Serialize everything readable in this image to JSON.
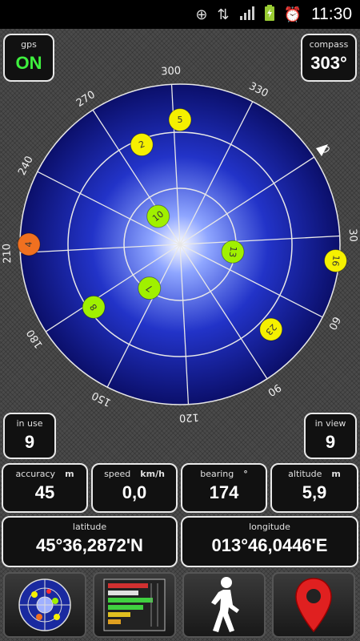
{
  "statusbar": {
    "time": "11:30",
    "icons": [
      "gps-icon",
      "data-transfer-icon",
      "signal-icon",
      "battery-icon",
      "alarm-icon"
    ]
  },
  "gps": {
    "label": "gps",
    "value": "ON"
  },
  "compass": {
    "label": "compass",
    "value": "303°"
  },
  "in_use": {
    "label": "in use",
    "value": "9"
  },
  "in_view": {
    "label": "in view",
    "value": "9"
  },
  "accuracy": {
    "label": "accuracy",
    "unit": "m",
    "value": "45"
  },
  "speed": {
    "label": "speed",
    "unit": "km/h",
    "value": "0,0"
  },
  "bearing": {
    "label": "bearing",
    "unit": "°",
    "value": "174"
  },
  "altitude": {
    "label": "altitude",
    "unit": "m",
    "value": "5,9"
  },
  "latitude": {
    "label": "latitude",
    "value": "45°36,2872'N"
  },
  "longitude": {
    "label": "longitude",
    "value": "013°46,0446'E"
  },
  "radar": {
    "rotation_deg": 303,
    "ticks": [
      "0",
      "30",
      "60",
      "90",
      "120",
      "150",
      "180",
      "210",
      "240",
      "270",
      "300",
      "330"
    ],
    "satellites": [
      {
        "id": "5",
        "azimuth": 303,
        "elevation": 20,
        "color": "#f5f000"
      },
      {
        "id": "2",
        "azimuth": 282,
        "elevation": 30,
        "color": "#f5f000"
      },
      {
        "id": "10",
        "azimuth": 265,
        "elevation": 70,
        "color": "#a0f000"
      },
      {
        "id": "4",
        "azimuth": 213,
        "elevation": 5,
        "color": "#f07020"
      },
      {
        "id": "8",
        "azimuth": 177,
        "elevation": 30,
        "color": "#a0f000"
      },
      {
        "id": "7",
        "azimuth": 158,
        "elevation": 60,
        "color": "#a0f000"
      },
      {
        "id": "13",
        "azimuth": 41,
        "elevation": 60,
        "color": "#a0f000"
      },
      {
        "id": "16",
        "azimuth": 39,
        "elevation": 2,
        "color": "#f5f000"
      },
      {
        "id": "23",
        "azimuth": 76,
        "elevation": 20,
        "color": "#f5f000"
      }
    ]
  },
  "toolbar": {
    "buttons": [
      "radar-view-icon",
      "signal-bars-icon",
      "walking-person-icon",
      "map-pin-icon"
    ]
  }
}
